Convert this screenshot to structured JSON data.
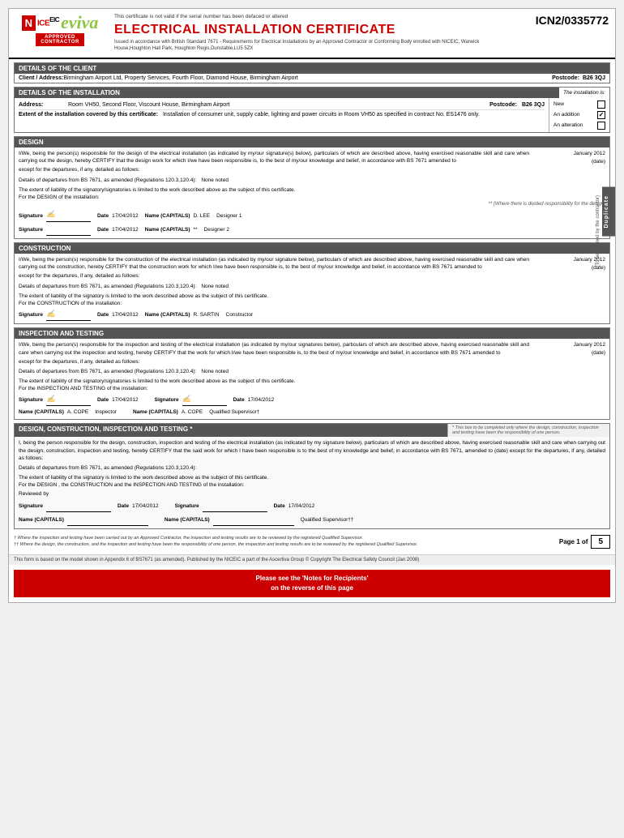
{
  "header": {
    "serial_label": "This certificate is not valid if the serial number has been defaced or altered",
    "serial_number": "ICN2/0335772",
    "title": "ELECTRICAL INSTALLATION CERTIFICATE",
    "subtitle": "Issued in accordance with British Standard 7671 - Requirements for Electrical Installations by an Approved Contractor or Conforming Body enrolled with NICEIC, Warwick House,Houghton Hall Park, Houghton Regis,Dunstable,LU5 5ZX"
  },
  "client": {
    "section_title": "DETAILS OF THE CLIENT",
    "label": "Client / Address:",
    "value": "Birmingham Airport Ltd, Property Services, Fourth Floor, Diamond House, Birmingham Airport",
    "postcode_label": "Postcode:",
    "postcode_value": "B26 3QJ"
  },
  "installation": {
    "section_title": "DETAILS OF THE INSTALLATION",
    "installation_is": "The installation is:",
    "address_label": "Address:",
    "address_value": "Room VH50, Second Floor, Viscount House, Birmingham Airport",
    "postcode_label": "Postcode:",
    "postcode_value": "B26 3QJ",
    "extent_label": "Extent of the installation covered by this certificate:",
    "extent_value": "Installation of consumer unit, supply cable, lighting and power circuits in Room VH50 as specified in contract No. ES1476 only.",
    "new_label": "New",
    "addition_label": "An addition",
    "alteration_label": "An alteration",
    "new_checked": false,
    "addition_checked": true,
    "alteration_checked": false
  },
  "design": {
    "section_title": "DESIGN",
    "cert_text_1": "I/We, being the person(s) responsible for the design of the electrical installation (as indicated by my/our signature(s) below), particulars of which are described above, having exercised reasonable skill and care when carrying out the design, hereby CERTIFY that the design work for which I/we have been responsible is, to the best of my/our knowledge and belief, in accordance with BS 7671 amended to",
    "date_amended": "January 2012",
    "date_label": "(date)",
    "cert_text_2": "except for the departures, if any, detailed as follows:",
    "departures_label": "Details of departures from BS 7671, as amended (Regulations 120.3,120.4):",
    "departures_value": "None noted",
    "extent_text": "The extent of liability of the signatory/signatories is limited to the work described above as the subject of this certificate.",
    "for_label": "For the DESIGN of the installation:",
    "divided_resp": "** (Where there is divided responsibility for the design)",
    "sig1_label": "Signature",
    "sig1_value": "",
    "date1_label": "Date",
    "date1_value": "17/04/2012",
    "name1_label": "Name (CAPITALS)",
    "name1_value": "D. LEE",
    "role1": "Designer 1",
    "sig2_label": "Signature",
    "sig2_value": "",
    "date2_label": "Date",
    "date2_value": "17/04/2012",
    "name2_label": "Name (CAPITALS)",
    "name2_value": "**",
    "role2": "Designer 2"
  },
  "construction": {
    "section_title": "CONSTRUCTION",
    "cert_text_1": "I/We, being the person(s) responsible for the construction of the electrical installation (as indicated by my/our signature below), particulars of which are described above, having exercised reasonable skill and care when carrying out the construction, hereby CERTIFY that the construction work for which I/we have been responsible is, to the best of my/our knowledge and belief, in accordance with BS 7671 amended to",
    "date_amended": "January 2012",
    "date_label": "(date)",
    "cert_text_2": "except for the departures, if any, detailed as follows:",
    "departures_label": "Details of departures from BS 7671, as amended (Regulations 120.3,120.4):",
    "departures_value": "None noted",
    "extent_text": "The extent of liability of the signatory is limited to the work described above as the subject of this certificate.",
    "for_label": "For the CONSTRUCTION of the installation:",
    "sig1_label": "Signature",
    "sig1_value": "",
    "date1_label": "Date",
    "date1_value": "17/04/2012",
    "name1_label": "Name (CAPITALS)",
    "name1_value": "R. SARTIN",
    "role1": "Constructor"
  },
  "inspection": {
    "section_title": "INSPECTION AND TESTING",
    "cert_text_1": "I/We, being the person(s) responsible for the inspection and testing of the electrical installation (as indicated by my/our signatures below), particulars of which are described above, having exercised reasonable skill and care when carrying out the inspection and testing, hereby CERTIFY that the work for which I/we have been responsible is, to the best of my/our knowledge and belief, in accordance with BS 7671 amended to",
    "date_amended": "January 2012",
    "date_label": "(date)",
    "cert_text_2": "except for the departures, if any, detailed as follows:",
    "departures_label": "Details of departures from BS 7671, as amended (Regulations 120.3,120.4):",
    "departures_value": "None noted",
    "extent_text": "The extent of liability of the signatory/signatories is limited to the work described above as the subject of this certificate.",
    "for_label": "For the INSPECTION AND TESTING of the installation:",
    "sig1_label": "Signature",
    "sig1_value": "",
    "date1_label": "Date",
    "date1_value": "17/04/2012",
    "sig2_label": "Signature",
    "sig2_value": "",
    "date2_label": "Date",
    "date2_value": "17/04/2012",
    "name1_label": "Name (CAPITALS)",
    "name1_value": "A. COPE",
    "role1": "Inspector",
    "name2_label": "Name (CAPITALS)",
    "name2_value": "A. COPE",
    "role2": "Qualified Supervisor†"
  },
  "design_construction": {
    "section_title": "DESIGN, CONSTRUCTION, INSPECTION AND TESTING *",
    "asterisk_note": "* This box to be completed only where the design, construction, inspection and testing have been the responsibility of one person.",
    "cert_text": "I, being the person responsible for the design, construction, inspection and testing of the electrical installation (as indicated by my signature below), particulars of which are described above, having exercised reasonable skill and care when carrying out the design, construction, inspection and testing, hereby CERTIFY that the said work for which I have been responsible is to the best of my knowledge and belief, in accordance with BS 7671, amended to",
    "date_amended": "(date)",
    "cert_text_2": "except for the departures, if any, detailed as follows:",
    "departures_label": "Details of departures from BS 7671, as amended (Regulations 120.3,120.4):",
    "extent_text": "The extent of liability of the signatory is limited to the work described above as the subject of this certificate.",
    "for_label": "For the DESIGN , the CONSTRUCTION and the INSPECTION AND TESTING of the installation:",
    "reviewed_label": "Reviewed by",
    "sig1_label": "Signature",
    "date1_label": "Date",
    "date1_value": "17/04/2012",
    "sig2_label": "Signature",
    "date2_label": "Date",
    "date2_value": "17/04/2012",
    "name1_label": "Name (CAPITALS)",
    "name2_label": "Name (CAPITALS)",
    "role2": "Qualified Supervisor††"
  },
  "footer": {
    "dagger1": "† Where the inspection and testing have been carried out by an Approved Contractor, the inspection and testing results are to be reviewed by the registered Qualified Supervisor.",
    "dagger2": "†† Where the design, the construction, and the inspection and testing have been the responsibility of one person, the inspection and testing results are to be reviewed by the registered Qualified Supervisor.",
    "page_label": "Page 1 of",
    "page_total": "5"
  },
  "bottom_bar": {
    "line1": "Please see the 'Notes for Recipients'",
    "line2": "on the reverse of this page"
  },
  "form_info": {
    "text": "This form is based on the model shown in Appendix 6 of BS7671 (as amended). Published by the NICEIC a part of the Ascertiva Group © Copyright The Electrical Safety Council (Jan 2008)"
  },
  "duplicate": {
    "label": "Duplicate",
    "note": "(To be retained by the contractor)"
  }
}
